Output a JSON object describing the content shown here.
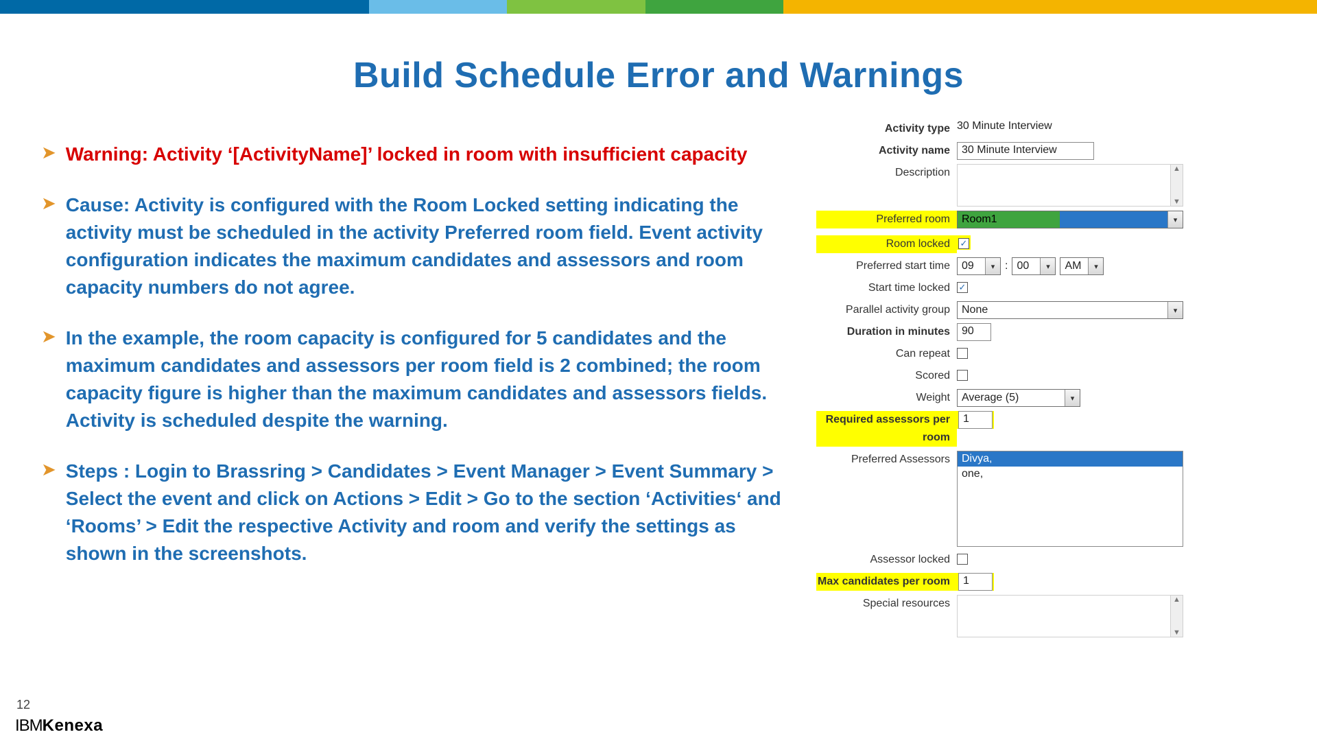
{
  "band_colors": [
    "#0069a6",
    "#6abde8",
    "#7fc241",
    "#3fa43f",
    "#f4b400",
    "#f4b400"
  ],
  "band_widths": [
    "28%",
    "10.5%",
    "10.5%",
    "10.5%",
    "10.5%",
    "30%"
  ],
  "title": "Build Schedule Error and Warnings",
  "bullets": {
    "b1": "Warning: Activity ‘[ActivityName]’ locked in room with insufficient capacity",
    "b2": "Cause: Activity is configured with the Room Locked setting indicating the activity must be scheduled in the activity Preferred room field. Event activity configuration indicates the maximum candidates and assessors and room capacity numbers do not agree.",
    "b3": "In the example, the room capacity is configured for 5 candidates and the maximum candidates and assessors per room field is 2 combined; the room capacity figure is higher than the maximum candidates and assessors fields. Activity is scheduled despite the warning.",
    "b4": "Steps : Login  to Brassring > Candidates > Event Manager > Event Summary > Select the event and click on Actions > Edit >  Go to the section ‘Activities‘ and ‘Rooms’ > Edit the respective Activity and room and verify the settings as shown in the screenshots."
  },
  "form": {
    "labels": {
      "activity_type": "Activity type",
      "activity_name": "Activity name",
      "description": "Description",
      "preferred_room": "Preferred room",
      "room_locked": "Room locked",
      "preferred_start_time": "Preferred start time",
      "start_time_locked": "Start time locked",
      "parallel_activity_group": "Parallel activity group",
      "duration": "Duration in minutes",
      "can_repeat": "Can repeat",
      "scored": "Scored",
      "weight": "Weight",
      "required_assessors": "Required assessors per room",
      "preferred_assessors": "Preferred Assessors",
      "assessor_locked": "Assessor locked",
      "max_candidates": "Max candidates per room",
      "special_resources": "Special resources"
    },
    "values": {
      "activity_type": "30 Minute Interview",
      "activity_name": "30 Minute Interview",
      "preferred_room": "Room1",
      "room_locked": true,
      "start_hour": "09",
      "start_minute": "00",
      "start_ampm": "AM",
      "start_time_sep": ":",
      "start_time_locked": true,
      "parallel_group": "None",
      "duration": "90",
      "can_repeat": false,
      "scored": false,
      "weight": "Average (5)",
      "required_assessors": "1",
      "preferred_assessors": [
        "Divya,",
        "one,"
      ],
      "assessor_locked": false,
      "max_candidates": "1"
    }
  },
  "page_number": "12",
  "logo": {
    "ibm": "IBM",
    "kenexa": "Kenexa"
  }
}
